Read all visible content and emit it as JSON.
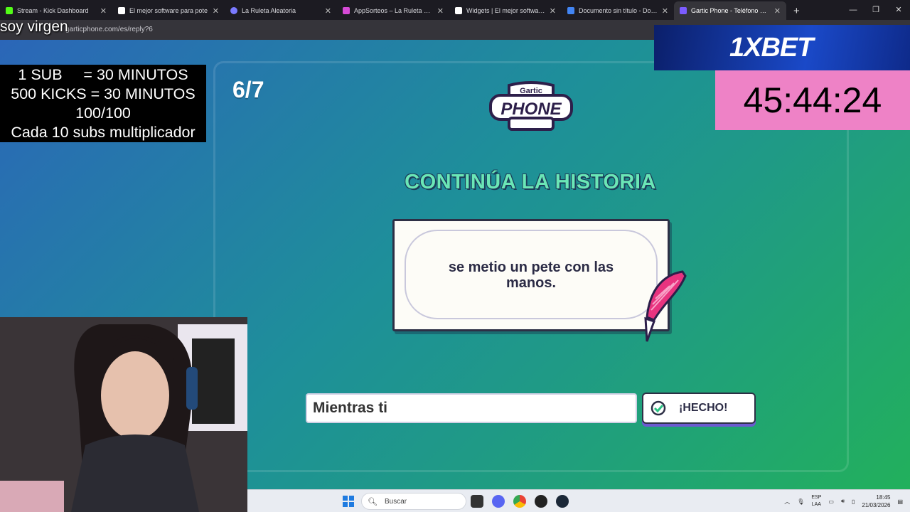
{
  "browser": {
    "tabs": [
      {
        "label": "Stream - Kick Dashboard",
        "color": "#53fc18"
      },
      {
        "label": "El mejor software para pote",
        "color": "#ffffff"
      },
      {
        "label": "La Ruleta Aleatoria",
        "color": "#7a7aff"
      },
      {
        "label": "AppSorteos – La Ruleta de la Su",
        "color": "#d64ad6"
      },
      {
        "label": "Widgets | El mejor software par",
        "color": "#ffffff"
      },
      {
        "label": "Documento sin título - Docume",
        "color": "#4285f4"
      },
      {
        "label": "Gartic Phone - Teléfono Descor",
        "color": "#7c5cff"
      }
    ],
    "new_tab": "+",
    "url": "garticphone.com/es/reply?6"
  },
  "overlay": {
    "title_text": "soy virgen",
    "subs_lines": [
      "1 SUB     = 30 MINUTOS",
      "500 KICKS = 30 MINUTOS",
      "100/100",
      "Cada 10 subs multiplicador"
    ],
    "ad_brand": "1XBET",
    "timer": "45:44:24"
  },
  "game": {
    "round": "6/7",
    "logo_top": "Gartic",
    "logo_bottom": "PHONE",
    "heading": "CONTINÚA LA HISTORIA",
    "story_text": "se metio un pete con las manos.",
    "answer_value": "Mientras ti",
    "done_label": "¡HECHO!"
  },
  "taskbar": {
    "search_placeholder": "Buscar",
    "lang_top": "ESP",
    "lang_bottom": "LAA",
    "time": "18:45",
    "date": "21/03/2026"
  }
}
